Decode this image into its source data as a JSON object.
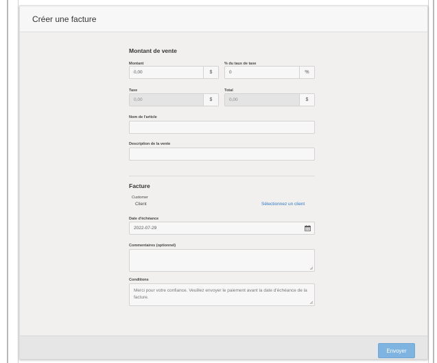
{
  "header": {
    "title": "Créer une facture"
  },
  "sales": {
    "section_title": "Montant de vente",
    "amount_label": "Montant",
    "amount_value": "0,00",
    "amount_addon": "$",
    "tax_rate_label": "% du taux de taxe",
    "tax_rate_value": "0",
    "tax_rate_addon": "%",
    "tax_label": "Taxe",
    "tax_value": "0,00",
    "tax_addon": "$",
    "total_label": "Total",
    "total_value": "0,00",
    "total_addon": "$",
    "item_name_label": "Nom de l'article",
    "item_name_value": "",
    "description_label": "Description de la vente",
    "description_value": ""
  },
  "invoice": {
    "section_title": "Facture",
    "customer_label": "Customer",
    "customer_value": "Client",
    "select_client_link": "Sélectionnez un client",
    "due_date_label": "Date d'échéance",
    "due_date_value": "2022-07-29",
    "comments_label": "Commentaires (optionnel)",
    "comments_value": "",
    "conditions_label": "Conditions",
    "conditions_value": "Merci pour votre confiance. Veuillez envoyer le paiement avant la date d'échéance de la facture."
  },
  "footer": {
    "submit_label": "Envoyer"
  },
  "colors": {
    "accent": "#7fb3e0",
    "link": "#2e77c6",
    "panel_bg": "#f1f0ef"
  }
}
